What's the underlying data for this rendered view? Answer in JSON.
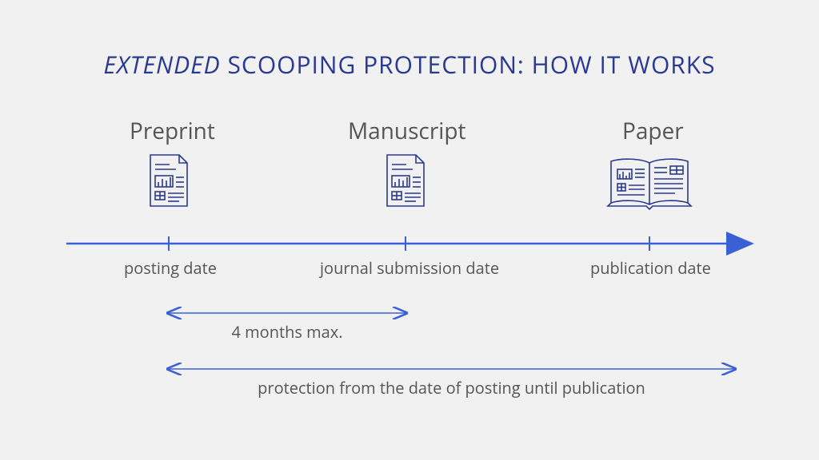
{
  "title": {
    "emphasis": "EXTENDED",
    "rest": " SCOOPING PROTECTION: HOW IT WORKS"
  },
  "stages": {
    "preprint": {
      "label": "Preprint",
      "tick": "posting date"
    },
    "manuscript": {
      "label": "Manuscript",
      "tick": "journal submission date"
    },
    "paper": {
      "label": "Paper",
      "tick": "publication date"
    }
  },
  "span1_label": "4 months max.",
  "span2_label": "protection from the date of posting until publication",
  "colors": {
    "accent": "#2a3990",
    "timeline": "#3a60d6",
    "arrows": "#3a60d6"
  }
}
